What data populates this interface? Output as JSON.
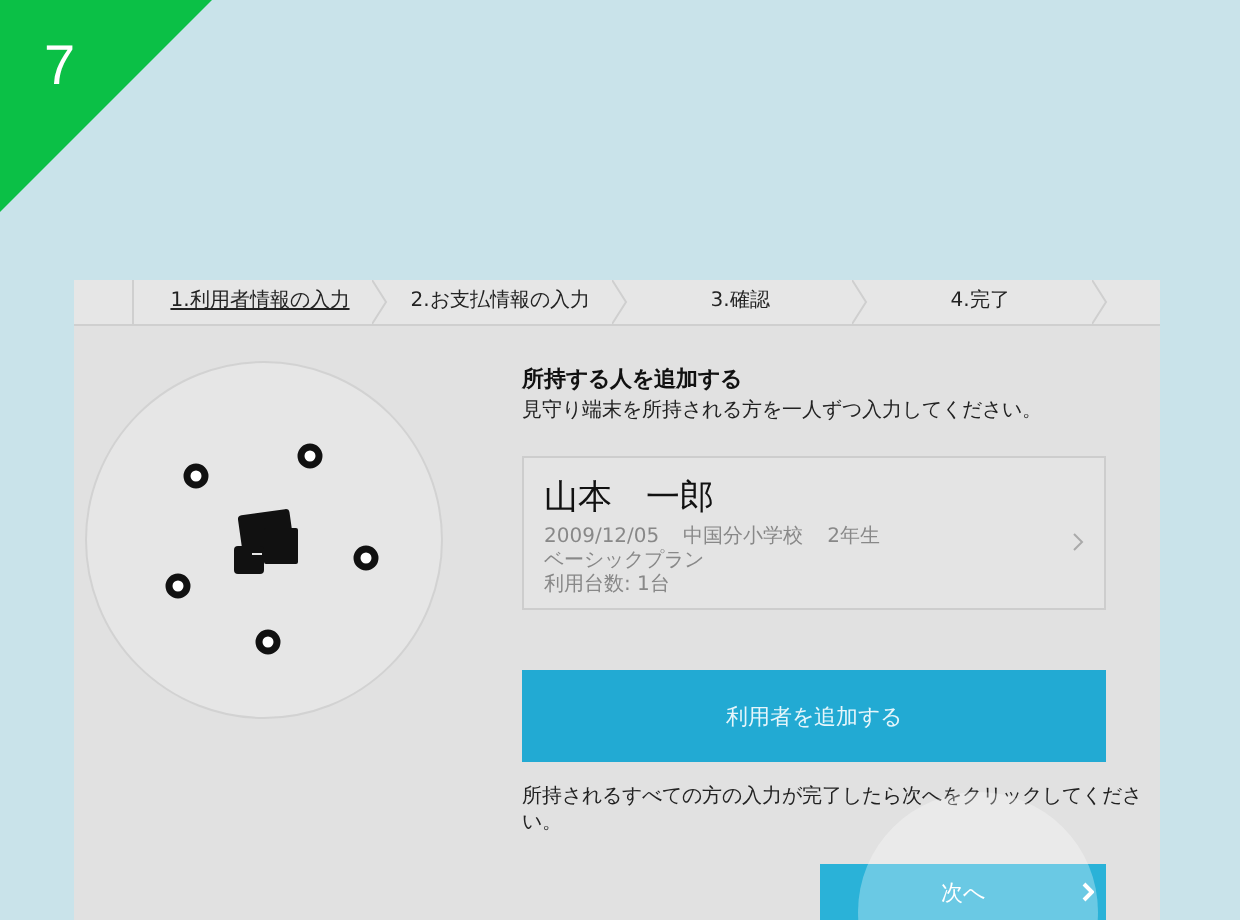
{
  "badge": {
    "label": "7"
  },
  "steps": [
    {
      "label": "1.利用者情報の入力",
      "selected": true
    },
    {
      "label": "2.お支払情報の入力",
      "selected": false
    },
    {
      "label": "3.確認",
      "selected": false
    },
    {
      "label": "4.完了",
      "selected": false
    }
  ],
  "heading": "所持する人を追加する",
  "instruction": "見守り端末を所持される方を一人ずつ入力してください。",
  "users": [
    {
      "name": "山本　一郎",
      "birthdate": "2009/12/05",
      "school": "中国分小学校",
      "grade": "2年生",
      "plan": "ベーシックプラン",
      "devices": "利用台数: 1台"
    }
  ],
  "add_button": {
    "label": "利用者を追加する"
  },
  "note": "所持されるすべての方の入力が完了したら次へをクリックしてください。",
  "next_button": {
    "label": "次へ",
    "pressed": true
  }
}
